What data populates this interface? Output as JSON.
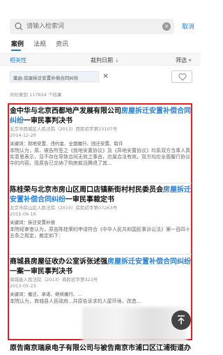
{
  "search": {
    "placeholder": "请输入检索词",
    "cancel_label": "取消"
  },
  "tabs": [
    {
      "label": "案例",
      "active": true
    },
    {
      "label": "法规",
      "active": false
    },
    {
      "label": "资讯",
      "active": false
    }
  ],
  "filters": {
    "relevance": "相关性",
    "date": "裁判日期",
    "screen": "筛选"
  },
  "active_filter_chip": "案由:房屋拆迁安置补偿合同纠纷",
  "total_results": "共检索到 117824 个结果",
  "cases": [
    {
      "title_plain": "金中华与北京西都地产发展有限公司",
      "title_highlight": "房屋拆迁安置补偿合同纠纷",
      "title_suffix": "一审民事判决书",
      "court_line": "北京市西城区人民法院（2013）西民初字第23107号",
      "date": "2014-12-20",
      "tags": "关键词：就地安置、违约金、全面履行、回迁安置、取许",
      "summary": "本院认为，原、被告所签之《就地安置协议》及《异地安置协议》均系双方当事人真实意思表示，且不存在导致合同无效之事由，应属合法有效。双方均应全面履行协议中的内容。现原告已交纳了购房款且腾退了其..."
    },
    {
      "title_plain": "陈桂荣与北京市房山区周口店镇新街村村民委员会",
      "title_highlight": "房屋拆迁安置补偿合同纠纷",
      "title_suffix": "一审民事裁定书",
      "court_line": "北京市房山区人民法院（2015）房民初字第07263号",
      "date": "2015-06-16",
      "tags": "关键词：拆迁安置补偿",
      "summary": "本院经审查认为，原告陈桂荣的申请符合《中华人民共和国民事诉讼法》第一百四十五条之规定，裁定如下："
    },
    {
      "title_plain": "商城县房屋征收办公室诉张述强",
      "title_highlight": "房屋拆迁安置补偿合同纠纷",
      "title_suffix": "一案一审民事判决书",
      "court_line": "商城县人民法院（2013）商民初字第323号",
      "date": "2013-05-23",
      "tags": "关键词：搬迁、承诺、继续履行、...",
      "summary": "本院认为，商城县人民政府...并原告诉求的人屋环境，改造..."
    }
  ],
  "bottom_case_title": "原告南京瑞泉电子有限公司与被告南京市浦口区江浦街道办"
}
